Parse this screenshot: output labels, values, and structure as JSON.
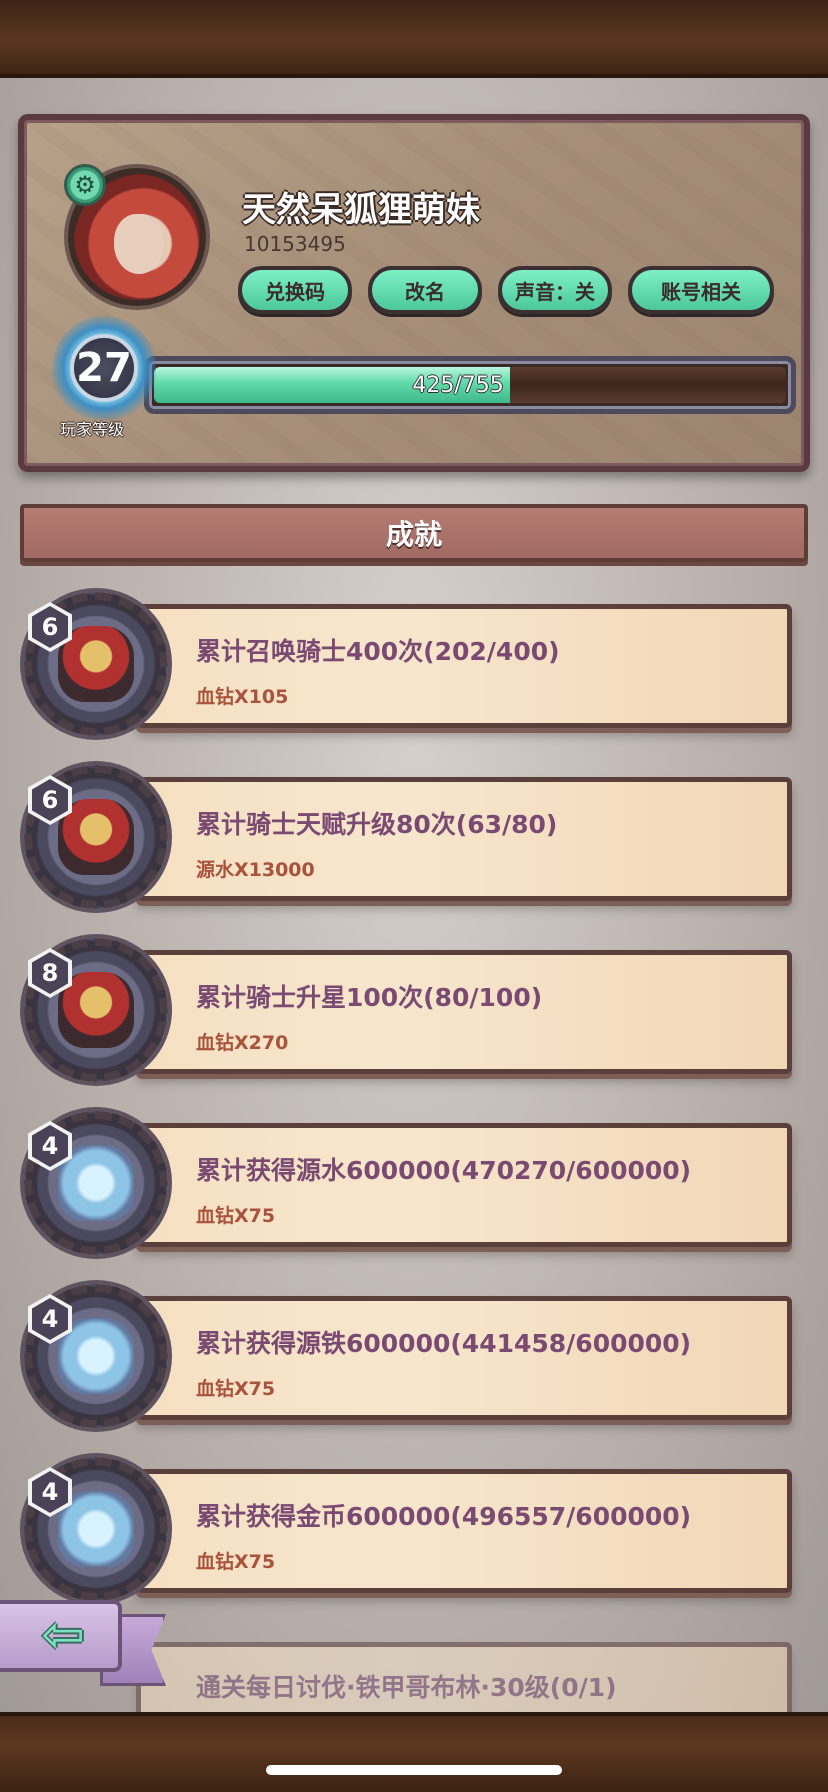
{
  "profile": {
    "name": "天然呆狐狸萌妹",
    "id": "10153495",
    "buttons": {
      "redeem": "兑换码",
      "rename": "改名",
      "sound": "声音：关",
      "account": "账号相关"
    },
    "level": "27",
    "level_label": "玩家等级",
    "xp_text": "425/755",
    "xp_fraction": 0.563
  },
  "section": {
    "title": "成就"
  },
  "achievements": [
    {
      "level": "6",
      "title": "累计召唤骑士400次(202/400)",
      "reward": "血钻X105",
      "icon": "knights-group-icon"
    },
    {
      "level": "6",
      "title": "累计骑士天赋升级80次(63/80)",
      "reward": "源水X13000",
      "icon": "knight-hat-icon"
    },
    {
      "level": "8",
      "title": "累计骑士升星100次(80/100)",
      "reward": "血钻X270",
      "icon": "knight-hat-icon"
    },
    {
      "level": "4",
      "title": "累计获得源水600000(470270/600000)",
      "reward": "血钻X75",
      "icon": "crystal-icon"
    },
    {
      "level": "4",
      "title": "累计获得源铁600000(441458/600000)",
      "reward": "血钻X75",
      "icon": "crystal-icon"
    },
    {
      "level": "4",
      "title": "累计获得金币600000(496557/600000)",
      "reward": "血钻X75",
      "icon": "crystal-icon"
    },
    {
      "level": "",
      "title": "通关每日讨伐·铁甲哥布林·30级(0/1)",
      "reward": "",
      "icon": "goblin-icon"
    }
  ],
  "colors": {
    "accent_green": "#5fd9a8",
    "title_purple": "#7a4a72",
    "reward_red": "#a9523c"
  }
}
